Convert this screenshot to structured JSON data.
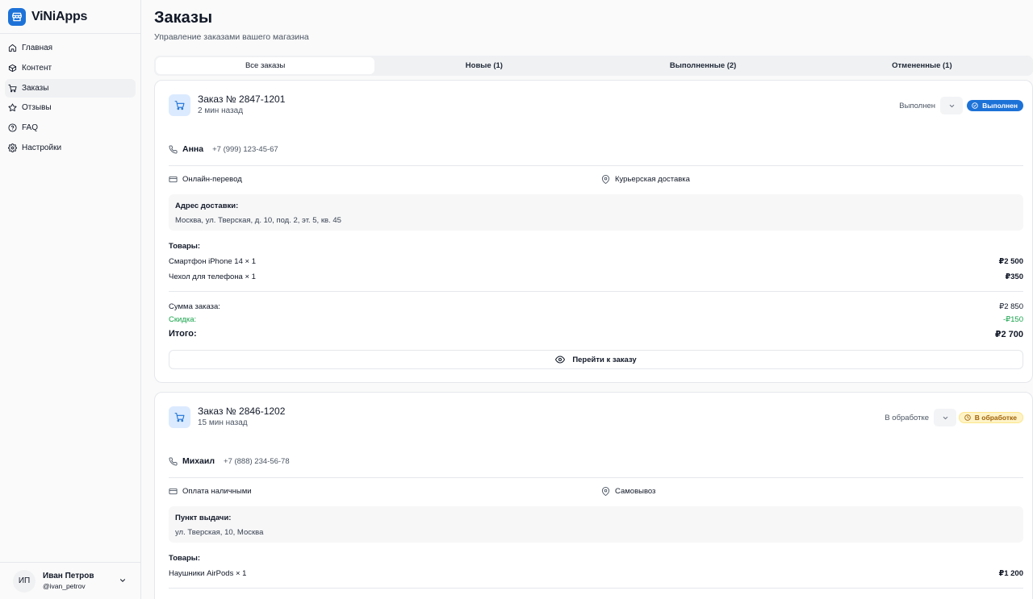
{
  "app": {
    "name": "ViNiApps"
  },
  "sidebar": {
    "items": [
      {
        "label": "Главная",
        "icon": "home-icon"
      },
      {
        "label": "Контент",
        "icon": "box-icon"
      },
      {
        "label": "Заказы",
        "icon": "cart-icon",
        "active": true
      },
      {
        "label": "Отзывы",
        "icon": "star-icon"
      },
      {
        "label": "FAQ",
        "icon": "help-circle-icon"
      },
      {
        "label": "Настройки",
        "icon": "gear-icon"
      }
    ],
    "user": {
      "initials": "ИП",
      "name": "Иван Петров",
      "handle": "@ivan_petrov"
    }
  },
  "page": {
    "title": "Заказы",
    "subtitle": "Управление заказами вашего магазина"
  },
  "tabs": [
    {
      "label": "Все заказы",
      "active": true
    },
    {
      "label": "Новые (1)"
    },
    {
      "label": "Выполненные (2)"
    },
    {
      "label": "Отмененные (1)"
    }
  ],
  "orders": [
    {
      "title": "Заказ № 2847-1201",
      "time": "2 мин назад",
      "status_select": "Выполнен",
      "badge": "Выполнен",
      "customer": {
        "name": "Анна",
        "phone": "+7 (999) 123-45-67"
      },
      "payment": "Онлайн-перевод",
      "delivery": "Курьерская доставка",
      "address_label": "Адрес доставки:",
      "address": "Москва, ул. Тверская, д. 10, под. 2, эт. 5, кв. 45",
      "goods_label": "Товары:",
      "items": [
        {
          "name": "Смартфон iPhone 14 × 1",
          "price": "₽2 500"
        },
        {
          "name": "Чехол для телефона × 1",
          "price": "₽350"
        }
      ],
      "sum_label": "Сумма заказа:",
      "sum": "₽2 850",
      "discount_label": "Скидка:",
      "discount": "-₽150",
      "total_label": "Итого:",
      "total": "₽2 700",
      "button": "Перейти к заказу"
    },
    {
      "title": "Заказ № 2846-1202",
      "time": "15 мин назад",
      "status_select": "В обработке",
      "badge": "В обработке",
      "customer": {
        "name": "Михаил",
        "phone": "+7 (888) 234-56-78"
      },
      "payment": "Оплата наличными",
      "delivery": "Самовывоз",
      "address_label": "Пункт выдачи:",
      "address": "ул. Тверская, 10, Москва",
      "goods_label": "Товары:",
      "items": [
        {
          "name": "Наушники AirPods × 1",
          "price": "₽1 200"
        }
      ]
    }
  ],
  "colors": {
    "accent": "#1d72d8",
    "success": "#16a34a",
    "warning_bg": "#fef3c7",
    "warning_text": "#a16207"
  }
}
